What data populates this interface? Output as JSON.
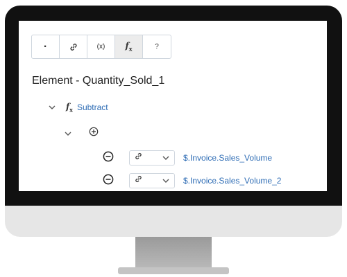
{
  "toolbar": {
    "buttons": [
      {
        "icon": "dot-icon",
        "label": "·"
      },
      {
        "icon": "link-icon",
        "label": ""
      },
      {
        "icon": "variable-icon",
        "label": "(x)"
      },
      {
        "icon": "function-icon",
        "label": "fx"
      },
      {
        "icon": "help-icon",
        "label": "?"
      }
    ]
  },
  "element": {
    "title": "Element - Quantity_Sold_1"
  },
  "tree": {
    "function_label": "Subtract",
    "arguments": [
      {
        "value": "$.Invoice.Sales_Volume"
      },
      {
        "value": "$.Invoice.Sales_Volume_2"
      }
    ]
  },
  "colors": {
    "link": "#2f6db5",
    "frame": "#111111",
    "chin": "#e6e6e6"
  }
}
